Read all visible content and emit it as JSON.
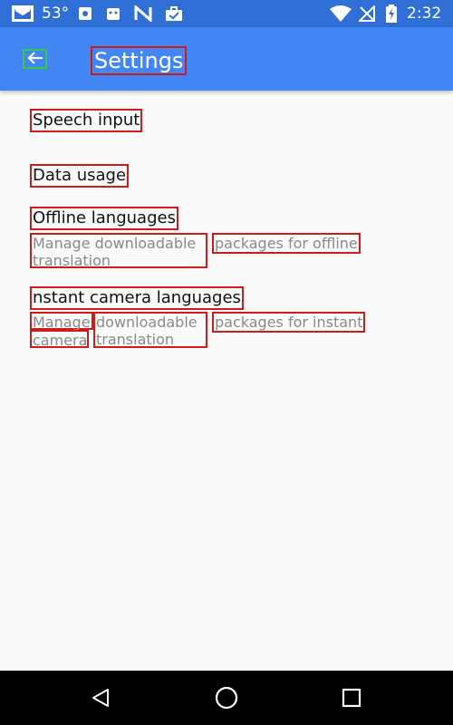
{
  "status_bar": {
    "temperature": "53°",
    "time": "2:32",
    "icons": [
      "mail-icon",
      "weather-icon",
      "android-icon",
      "android-icon",
      "n-icon",
      "briefcase-icon",
      "wifi-icon",
      "no-signal-icon",
      "battery-charging-icon"
    ]
  },
  "app_bar": {
    "back_icon": "back-arrow-icon",
    "title": "Settings"
  },
  "settings": {
    "speech_input": "Speech input",
    "data_usage": "Data usage",
    "offline_languages": {
      "title": "Offline languages",
      "summary_parts": [
        "Manage downloadable",
        "packages for offline",
        "translation"
      ]
    },
    "instant_camera_languages": {
      "title": "nstant camera languages",
      "summary_parts": [
        "Manage",
        "downloadable",
        "packages for instant",
        "camera",
        "translation"
      ]
    }
  },
  "nav_bar": {
    "icons": [
      "back-triangle-icon",
      "home-circle-icon",
      "recents-square-icon"
    ]
  }
}
